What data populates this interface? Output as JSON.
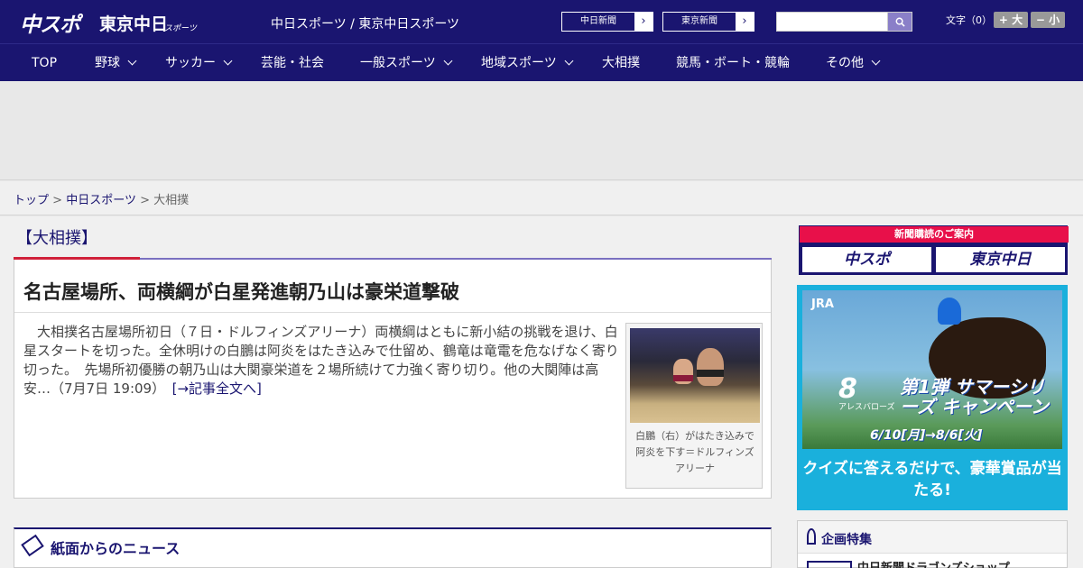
{
  "header": {
    "logo_main": "中スポ",
    "logo_tokyo": "東京中日",
    "logo_tokyo_sub": "スポーツ",
    "site_title": "中日スポーツ / 東京中日スポーツ",
    "paper_links": [
      {
        "label": "中日新聞",
        "arrow": "›"
      },
      {
        "label": "東京新聞",
        "arrow": "›"
      }
    ],
    "search": {
      "placeholder": "",
      "button_icon": "search-icon",
      "button_glyph": "🔍"
    },
    "font_size": {
      "label": "文字（0）",
      "larger": "+ 大",
      "smaller": "− 小"
    }
  },
  "nav": [
    {
      "label": "TOP",
      "has_menu": false
    },
    {
      "label": "野球",
      "has_menu": true
    },
    {
      "label": "サッカー",
      "has_menu": true
    },
    {
      "label": "芸能・社会",
      "has_menu": false
    },
    {
      "label": "一般スポーツ",
      "has_menu": true
    },
    {
      "label": "地域スポーツ",
      "has_menu": true
    },
    {
      "label": "大相撲",
      "has_menu": false
    },
    {
      "label": "競馬・ボート・競輪",
      "has_menu": false
    },
    {
      "label": "その他",
      "has_menu": true
    }
  ],
  "breadcrumb": {
    "items": [
      "トップ",
      "中日スポーツ",
      "大相撲"
    ],
    "separator": ">"
  },
  "category": {
    "title": "【大相撲】"
  },
  "article": {
    "headline": "名古屋場所、両横綱が白星発進朝乃山は豪栄道撃破",
    "body": "大相撲名古屋場所初日（７日・ドルフィンズアリーナ）両横綱はともに新小結の挑戦を退け、白星スタートを切った。全休明けの白鵬は阿炎をはたき込みで仕留め、鶴竜は竜電を危なげなく寄り切った。　先場所初優勝の朝乃山は大関豪栄道を２場所続けて力強く寄り切り。他の大関陣は高安…（7月7日 19:09）",
    "more_link": "[→記事全文へ]",
    "photo_caption": "白鵬（右）がはたき込みで阿炎を下す＝ドルフィンズアリーナ"
  },
  "news_section": {
    "title": "紙面からのニュース",
    "icon": "newspaper-icon"
  },
  "sidebar": {
    "subscribe": {
      "header": "新聞購読のご案内",
      "buttons": [
        "中スポ",
        "東京中日"
      ]
    },
    "jra_ad": {
      "logo": "JRA",
      "number": "8",
      "number_sub": "アレスバローズ",
      "campaign": "第1弾 サマーシリーズ キャンペーン",
      "dates": "6/10[月]→8/6[火]",
      "quiz": "クイズに答えるだけで、豪華賞品が当たる!",
      "colors": {
        "background": "#1ab0dc"
      }
    },
    "special": {
      "title": "企画特集",
      "item": "中日新聞ドラゴンズショップ"
    }
  },
  "colors": {
    "brand_navy": "#1a1570",
    "accent_red": "#d0213a",
    "accent_purple": "#7a70c0"
  }
}
